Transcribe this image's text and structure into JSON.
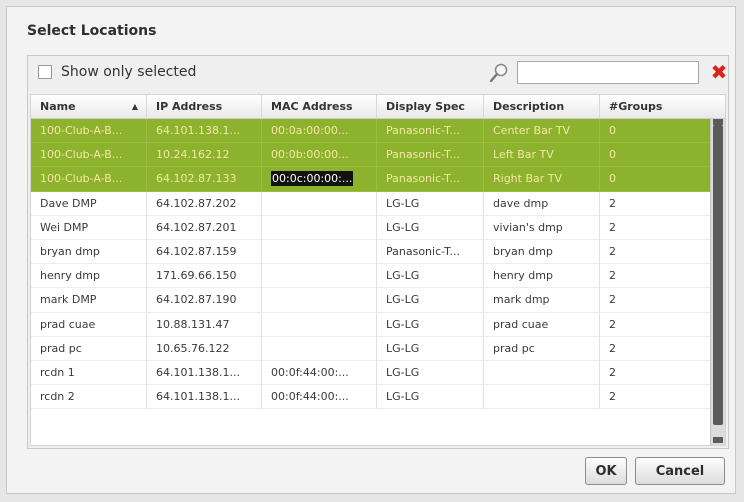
{
  "dialog": {
    "title": "Select Locations"
  },
  "filter": {
    "show_only_selected_label": "Show only selected",
    "show_only_selected": false,
    "search_value": ""
  },
  "columns": [
    "Name",
    "IP Address",
    "MAC Address",
    "Display Spec",
    "Description",
    "#Groups"
  ],
  "sort": {
    "column": "Name",
    "direction": "ascending"
  },
  "rows": [
    {
      "name": "100-Club-A-B...",
      "ip": "64.101.138.1...",
      "mac": "00:0a:00:00...",
      "display": "Panasonic-T...",
      "desc": "Center Bar TV",
      "groups": "0",
      "selected": true
    },
    {
      "name": "100-Club-A-B...",
      "ip": "10.24.162.12",
      "mac": "00:0b:00:00...",
      "display": "Panasonic-T...",
      "desc": "Left Bar TV",
      "groups": "0",
      "selected": true
    },
    {
      "name": "100-Club-A-B...",
      "ip": "64.102.87.133",
      "mac": "00:0c:00:00:...",
      "display": "Panasonic-T...",
      "desc": "Right Bar TV",
      "groups": "0",
      "selected": true
    },
    {
      "name": "Dave DMP",
      "ip": "64.102.87.202",
      "mac": "",
      "display": "LG-LG",
      "desc": "dave dmp",
      "groups": "2",
      "selected": false
    },
    {
      "name": "Wei DMP",
      "ip": "64.102.87.201",
      "mac": "",
      "display": "LG-LG",
      "desc": "vivian's dmp",
      "groups": "2",
      "selected": false
    },
    {
      "name": "bryan dmp",
      "ip": "64.102.87.159",
      "mac": "",
      "display": "Panasonic-T...",
      "desc": "bryan dmp",
      "groups": "2",
      "selected": false
    },
    {
      "name": "henry dmp",
      "ip": "171.69.66.150",
      "mac": "",
      "display": "LG-LG",
      "desc": "henry dmp",
      "groups": "2",
      "selected": false
    },
    {
      "name": "mark DMP",
      "ip": "64.102.87.190",
      "mac": "",
      "display": "LG-LG",
      "desc": "mark dmp",
      "groups": "2",
      "selected": false
    },
    {
      "name": "prad cuae",
      "ip": "10.88.131.47",
      "mac": "",
      "display": "LG-LG",
      "desc": "prad cuae",
      "groups": "2",
      "selected": false
    },
    {
      "name": "prad pc",
      "ip": "10.65.76.122",
      "mac": "",
      "display": "LG-LG",
      "desc": "prad pc",
      "groups": "2",
      "selected": false
    },
    {
      "name": "rcdn 1",
      "ip": "64.101.138.1...",
      "mac": "00:0f:44:00:...",
      "display": "LG-LG",
      "desc": "",
      "groups": "2",
      "selected": false
    },
    {
      "name": "rcdn 2",
      "ip": "64.101.138.1...",
      "mac": "00:0f:44:00:...",
      "display": "LG-LG",
      "desc": "",
      "groups": "2",
      "selected": false
    }
  ],
  "highlighted_cell": {
    "row": 2,
    "column": "mac"
  },
  "buttons": {
    "ok": "OK",
    "cancel": "Cancel"
  },
  "colors": {
    "selected_row": "#8db22e",
    "selected_text": "#f4e7a3",
    "clear_icon": "#d9221b"
  },
  "icons": [
    "search-icon",
    "clear-icon",
    "sort-ascending-icon"
  ]
}
